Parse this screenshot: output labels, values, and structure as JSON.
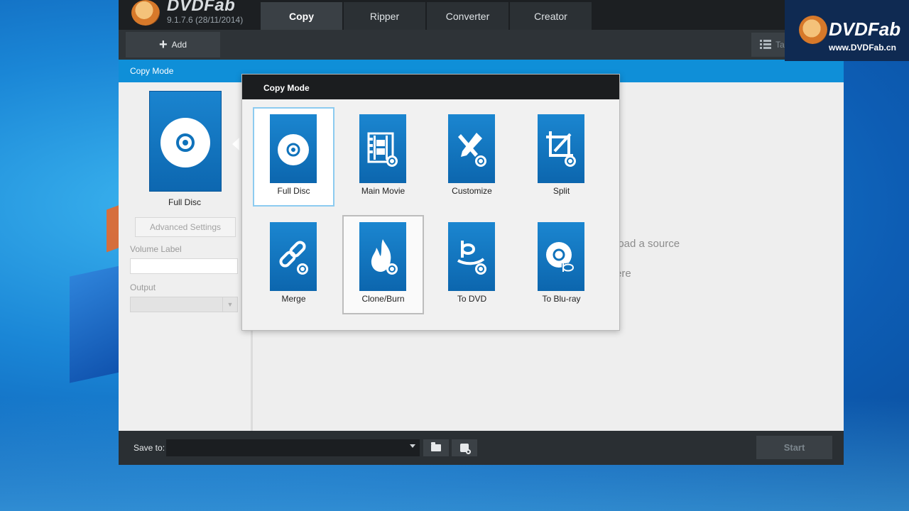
{
  "app": {
    "name": "DVDFab",
    "version": "9.1.7.6 (28/11/2014)"
  },
  "tabs": [
    {
      "label": "Copy",
      "active": true
    },
    {
      "label": "Ripper"
    },
    {
      "label": "Converter"
    },
    {
      "label": "Creator"
    }
  ],
  "toolbar": {
    "add_label": "Add",
    "task_label": "Tas"
  },
  "mode_bar": {
    "label": "Copy Mode"
  },
  "left_panel": {
    "current_mode": "Full Disc",
    "advanced_settings": "Advanced Settings",
    "volume_label": "Volume Label",
    "volume_value": "",
    "output_label": "Output",
    "output_value": ""
  },
  "hints": {
    "line1": "load a source",
    "line2": "ere"
  },
  "modal": {
    "title": "Copy Mode",
    "modes": [
      {
        "label": "Full Disc",
        "icon": "disc-icon",
        "selected": true
      },
      {
        "label": "Main Movie",
        "icon": "film-icon"
      },
      {
        "label": "Customize",
        "icon": "customize-icon"
      },
      {
        "label": "Split",
        "icon": "split-icon"
      },
      {
        "label": "Merge",
        "icon": "merge-icon"
      },
      {
        "label": "Clone/Burn",
        "icon": "flame-icon",
        "hovered": true
      },
      {
        "label": "To DVD",
        "icon": "to-dvd-icon"
      },
      {
        "label": "To Blu-ray",
        "icon": "to-bluray-icon"
      }
    ]
  },
  "footer": {
    "save_to_label": "Save to:",
    "save_to_value": "",
    "start_label": "Start"
  },
  "watermark": {
    "name": "DVDFab",
    "url": "www.DVDFab.cn"
  },
  "colors": {
    "accent": "#0f8fd8",
    "tile": "#1277c2",
    "dark": "#1f2326"
  }
}
